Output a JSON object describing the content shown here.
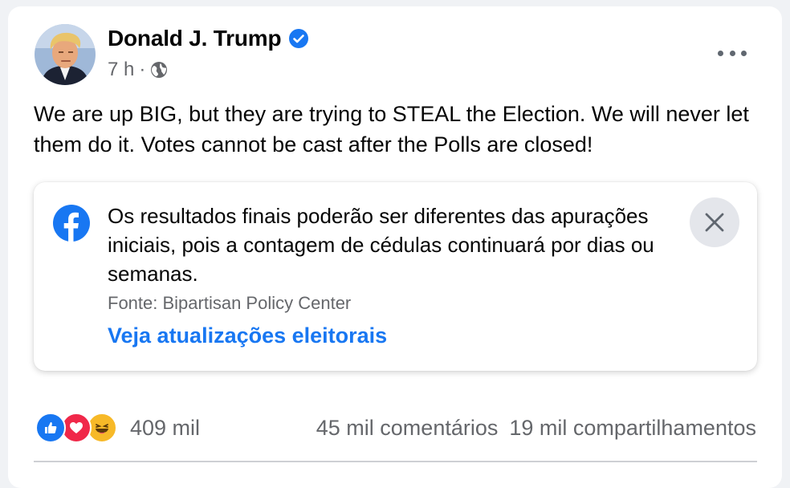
{
  "post": {
    "author": "Donald J. Trump",
    "time": "7 h",
    "separator": "·",
    "text": "We are up BIG, but they are trying to STEAL the Election. We will never let them do it. Votes cannot be cast after the Polls are closed!"
  },
  "notice": {
    "text": "Os resultados finais poderão ser diferentes das apurações iniciais, pois a contagem de cédulas continuará por dias ou semanas.",
    "source": "Fonte: Bipartisan Policy Center",
    "link": "Veja atualizações eleitorais"
  },
  "engagement": {
    "reactions_count": "409 mil",
    "comments": "45 mil comentários",
    "shares": "19 mil compartilhamentos"
  },
  "icons": [
    "avatar",
    "verified-badge-icon",
    "globe-icon",
    "more-options-icon",
    "facebook-logo-icon",
    "close-icon",
    "like-reaction-icon",
    "love-reaction-icon",
    "haha-reaction-icon"
  ],
  "colors": {
    "accent": "#1877f2",
    "secondary_text": "#65676b",
    "close_bg": "#e4e6eb"
  }
}
